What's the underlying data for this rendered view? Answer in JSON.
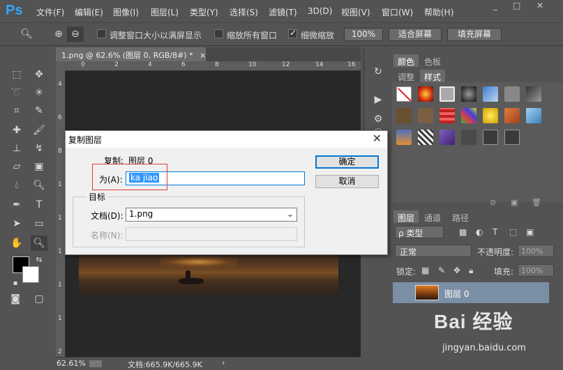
{
  "app": {
    "logo": "Ps"
  },
  "menu": [
    "文件(F)",
    "编辑(E)",
    "图像(I)",
    "图层(L)",
    "类型(Y)",
    "选择(S)",
    "滤镜(T)",
    "3D(D)",
    "视图(V)",
    "窗口(W)",
    "帮助(H)"
  ],
  "options": {
    "resize_windows": "调整窗口大小以满屏显示",
    "zoom_all": "缩放所有窗口",
    "scrubby_zoom": "细微缩放",
    "zoom_value": "100%",
    "fit_screen": "适合屏幕",
    "fill_screen": "填充屏幕"
  },
  "document": {
    "tab_title": "1.png @ 62.6% (图层 0, RGB/8#) *",
    "zoom": "62.61%",
    "doc_size": "文档:665.9K/665.9K"
  },
  "ruler": {
    "h": [
      "0",
      "2",
      "4",
      "6",
      "8",
      "10",
      "12",
      "14",
      "16"
    ],
    "v": [
      "4",
      "6",
      "8",
      "1",
      "1",
      "1",
      "1",
      "1",
      "2"
    ]
  },
  "panels": {
    "color_tab": "颜色",
    "swatches_tab": "色板",
    "adjust_tab": "调整",
    "styles_tab": "样式",
    "layers_tab": "图层",
    "channels_tab": "通道",
    "paths_tab": "路径",
    "kind_filter": "ρ 类型",
    "blend_mode": "正常",
    "opacity_label": "不透明度:",
    "opacity_value": "100%",
    "lock_label": "锁定:",
    "fill_label": "填充:",
    "fill_value": "100%",
    "layer_name": "图层 0"
  },
  "dialog": {
    "title": "复制图层",
    "copy_label": "复制:",
    "copy_value": "图层 0",
    "as_label": "为(A):",
    "as_value": "ka jiao",
    "ok": "确定",
    "cancel": "取消",
    "dest_label": "目标",
    "doc_label": "文档(D):",
    "doc_value": "1.png",
    "name_label": "名称(N):"
  },
  "watermark": {
    "main": "Bai 经验",
    "sub": "jingyan.baidu.com"
  }
}
